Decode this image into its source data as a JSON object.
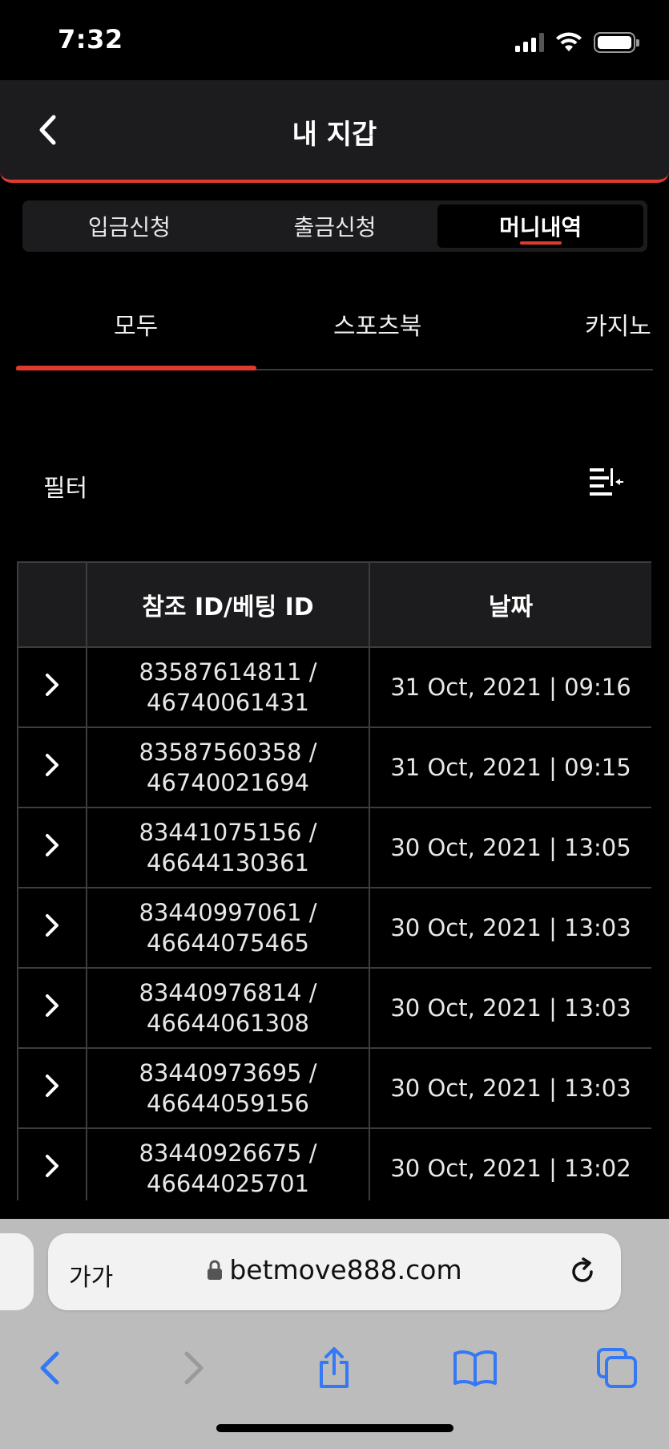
{
  "status_bar": {
    "time": "7:32"
  },
  "header": {
    "title": "내 지갑"
  },
  "segments": [
    {
      "label": "입금신청",
      "active": false
    },
    {
      "label": "출금신청",
      "active": false
    },
    {
      "label": "머니내역",
      "active": true
    }
  ],
  "subtabs": [
    {
      "label": "모두",
      "active": true
    },
    {
      "label": "스포츠북",
      "active": false
    },
    {
      "label": "카지노",
      "active": false
    }
  ],
  "filter": {
    "label": "필터"
  },
  "table": {
    "columns": [
      "",
      "참조 ID/베팅 ID",
      "날짜"
    ],
    "rows": [
      {
        "ref_id": "83587614811 /",
        "bet_id": "46740061431",
        "date": "31 Oct, 2021 | 09:16"
      },
      {
        "ref_id": "83587560358 /",
        "bet_id": "46740021694",
        "date": "31 Oct, 2021 | 09:15"
      },
      {
        "ref_id": "83441075156 /",
        "bet_id": "46644130361",
        "date": "30 Oct, 2021 | 13:05"
      },
      {
        "ref_id": "83440997061 /",
        "bet_id": "46644075465",
        "date": "30 Oct, 2021 | 13:03"
      },
      {
        "ref_id": "83440976814 /",
        "bet_id": "46644061308",
        "date": "30 Oct, 2021 | 13:03"
      },
      {
        "ref_id": "83440973695 /",
        "bet_id": "46644059156",
        "date": "30 Oct, 2021 | 13:03"
      },
      {
        "ref_id": "83440926675 /",
        "bet_id": "46644025701",
        "date": "30 Oct, 2021 | 13:02"
      }
    ]
  },
  "browser": {
    "text_size_label": "가가",
    "url": "betmove888.com"
  },
  "colors": {
    "accent": "#e03a2f",
    "background": "#000000",
    "surface": "#1c1c1e",
    "safari_blue": "#3478f6"
  }
}
